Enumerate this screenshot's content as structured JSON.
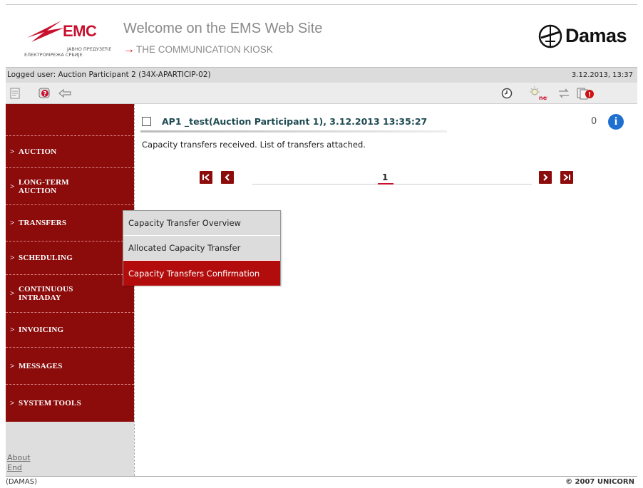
{
  "header": {
    "emc_brand": "EMC",
    "emc_sub1": "ЈАВНО ПРЕДУЗЕЋЕ",
    "emc_sub2": "ЕЛЕКТРОМРЕЖА СРБИЈЕ",
    "welcome": "Welcome on the EMS Web Site",
    "kiosk": "THE COMMUNICATION KIOSK",
    "damas_brand": "Damas"
  },
  "user_bar": {
    "logged_user": "Logged user: Auction Participant 2 (34X-APARTICIP-02)",
    "datetime": "3.12.2013, 13:37"
  },
  "toolbar": {
    "icons": [
      "document-icon",
      "help-icon",
      "back-arrow-icon",
      "clock-icon",
      "new-bulb-icon",
      "transfer-arrows-icon",
      "alert-documents-icon"
    ],
    "new_badge": "new"
  },
  "sidebar": {
    "items": [
      {
        "label": "AUCTION"
      },
      {
        "label": "LONG-TERM",
        "label2": "AUCTION"
      },
      {
        "label": "TRANSFERS"
      },
      {
        "label": "SCHEDULING"
      },
      {
        "label": "CONTINUOUS",
        "label2": "INTRADAY"
      },
      {
        "label": "INVOICING"
      },
      {
        "label": "MESSAGES"
      },
      {
        "label": "SYSTEM TOOLS"
      }
    ],
    "chevron": ">",
    "about": "About",
    "end": "End"
  },
  "message": {
    "title": "AP1 _test(Auction Participant 1), 3.12.2013 13:35:27",
    "attach_glyph": "0",
    "info_glyph": "i",
    "body": "Capacity transfers received. List of transfers attached."
  },
  "pager": {
    "first": "K",
    "prev": "<",
    "page": "1",
    "next": ">",
    "last": ">|"
  },
  "dropdown": {
    "items": [
      {
        "label": "Capacity Transfer Overview",
        "active": false
      },
      {
        "label": "Allocated Capacity Transfer",
        "active": false
      },
      {
        "label": "Capacity Transfers Confirmation",
        "active": true
      }
    ]
  },
  "footer": {
    "left": "(DAMAS)",
    "right": "© 2007 UNICORN"
  },
  "colors": {
    "sidebar_bg": "#8c0b0b",
    "active_menu": "#b30c0c",
    "brand_red": "#c8102e",
    "info_blue": "#1e6fd0"
  }
}
